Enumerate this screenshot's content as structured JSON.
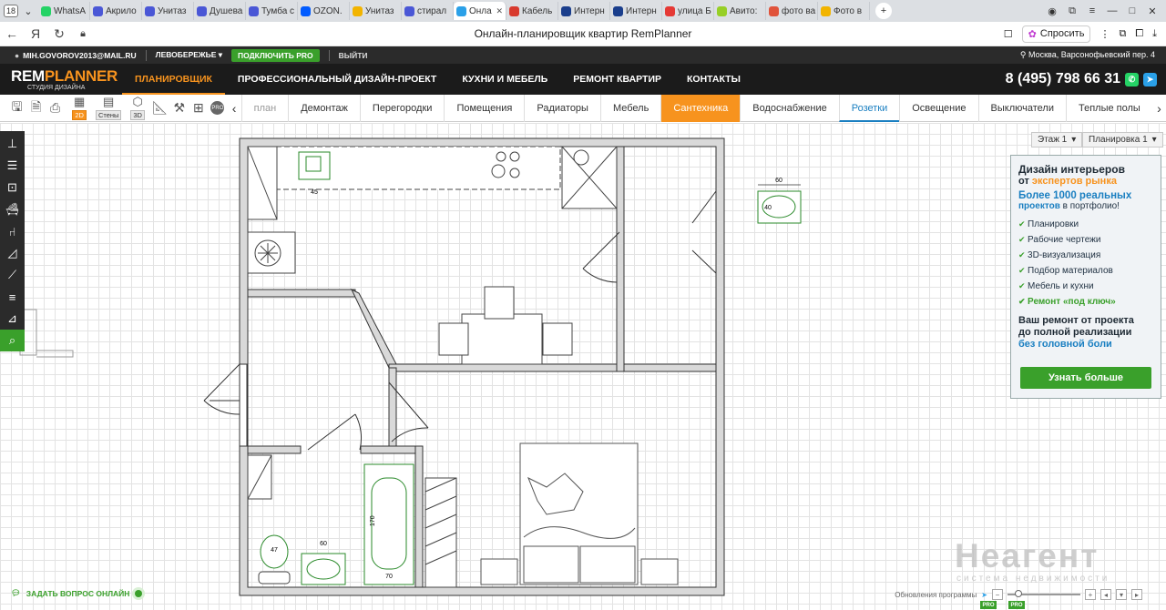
{
  "browser": {
    "tab_count": "18",
    "tabs": [
      {
        "label": "WhatsA",
        "color": "#25d366"
      },
      {
        "label": "Акрило",
        "color": "#4a57d6"
      },
      {
        "label": "Унитаз",
        "color": "#4a57d6"
      },
      {
        "label": "Душева",
        "color": "#4a57d6"
      },
      {
        "label": "Тумба с",
        "color": "#4a57d6"
      },
      {
        "label": "OZON.",
        "color": "#005bff"
      },
      {
        "label": "Унитаз",
        "color": "#f2b400"
      },
      {
        "label": "стирал",
        "color": "#4a57d6"
      },
      {
        "label": "Онла",
        "color": "#2aa0e8",
        "active": true
      },
      {
        "label": "Кабель",
        "color": "#d83a2e"
      },
      {
        "label": "Интерн",
        "color": "#1a3e8c"
      },
      {
        "label": "Интерн",
        "color": "#1a3e8c"
      },
      {
        "label": "улица Б",
        "color": "#e53935"
      },
      {
        "label": "Авито:",
        "color": "#97cf26"
      },
      {
        "label": "фото ва",
        "color": "#e0533b"
      },
      {
        "label": "Фото в",
        "color": "#f2b400"
      }
    ],
    "page_title": "Онлайн-планировщик квартир RemPlanner",
    "ask_label": "Спросить"
  },
  "topline": {
    "email": "MIH.GOVOROV2013@MAIL.RU",
    "region": "ЛЕВОБЕРЕЖЬЕ ▾",
    "pro_button": "ПОДКЛЮЧИТЬ PRO",
    "logout": "ВЫЙТИ",
    "location": "Москва, Варсонофьевский пер. 4"
  },
  "mainnav": {
    "logo_main_a": "REM",
    "logo_main_b": "PLANNER",
    "logo_sub": "СТУДИЯ ДИЗАЙНА",
    "items": [
      "ПЛАНИРОВЩИК",
      "ПРОФЕССИОНАЛЬНЫЙ ДИЗАЙН-ПРОЕКТ",
      "КУХНИ И МЕБЕЛЬ",
      "РЕМОНТ КВАРТИР",
      "КОНТАКТЫ"
    ],
    "phone": "8 (495) 798 66 31"
  },
  "toolbar": {
    "mode_2d": "2D",
    "mode_walls": "Стены",
    "mode_3d": "3D",
    "pro_badge": "PRO",
    "categories": [
      "план",
      "Демонтаж",
      "Перегородки",
      "Помещения",
      "Радиаторы",
      "Мебель",
      "Сантехника",
      "Водоснабжение",
      "Розетки",
      "Освещение",
      "Выключатели",
      "Теплые полы"
    ],
    "selected_category": "Сантехника",
    "highlighted_category": "Розетки"
  },
  "canvas": {
    "floor_dropdown": "Этаж 1",
    "plan_dropdown": "Планировка 1",
    "dims": {
      "sink_kitchen": "45",
      "sink_small_w": "60",
      "sink_small_h": "40",
      "bath_len": "170",
      "bath_w": "70",
      "toilet": "47",
      "bath_sink": "60"
    }
  },
  "promo": {
    "line1": "Дизайн интерьеров",
    "line2_a": "от ",
    "line2_b": "экспертов рынка",
    "g1": "Более 1000 реальных",
    "g2_a": "проектов",
    "g2_b": " в портфолио!",
    "list": [
      "Планировки",
      "Рабочие чертежи",
      "3D-визуализация",
      "Подбор материалов",
      "Мебель и кухни",
      "Ремонт «под ключ»"
    ],
    "foot1": "Ваш ремонт от проекта",
    "foot2": "до полной реализации",
    "foot3": "без головной боли",
    "button": "Узнать больше"
  },
  "bottom": {
    "ask_online": "ЗАДАТЬ ВОПРОС ОНЛАЙН",
    "updates": "Обновления программы",
    "pro_a": "PRO",
    "pro_b": "PRO"
  },
  "watermark": {
    "main": "Неагент",
    "sub": "система недвижимости"
  }
}
